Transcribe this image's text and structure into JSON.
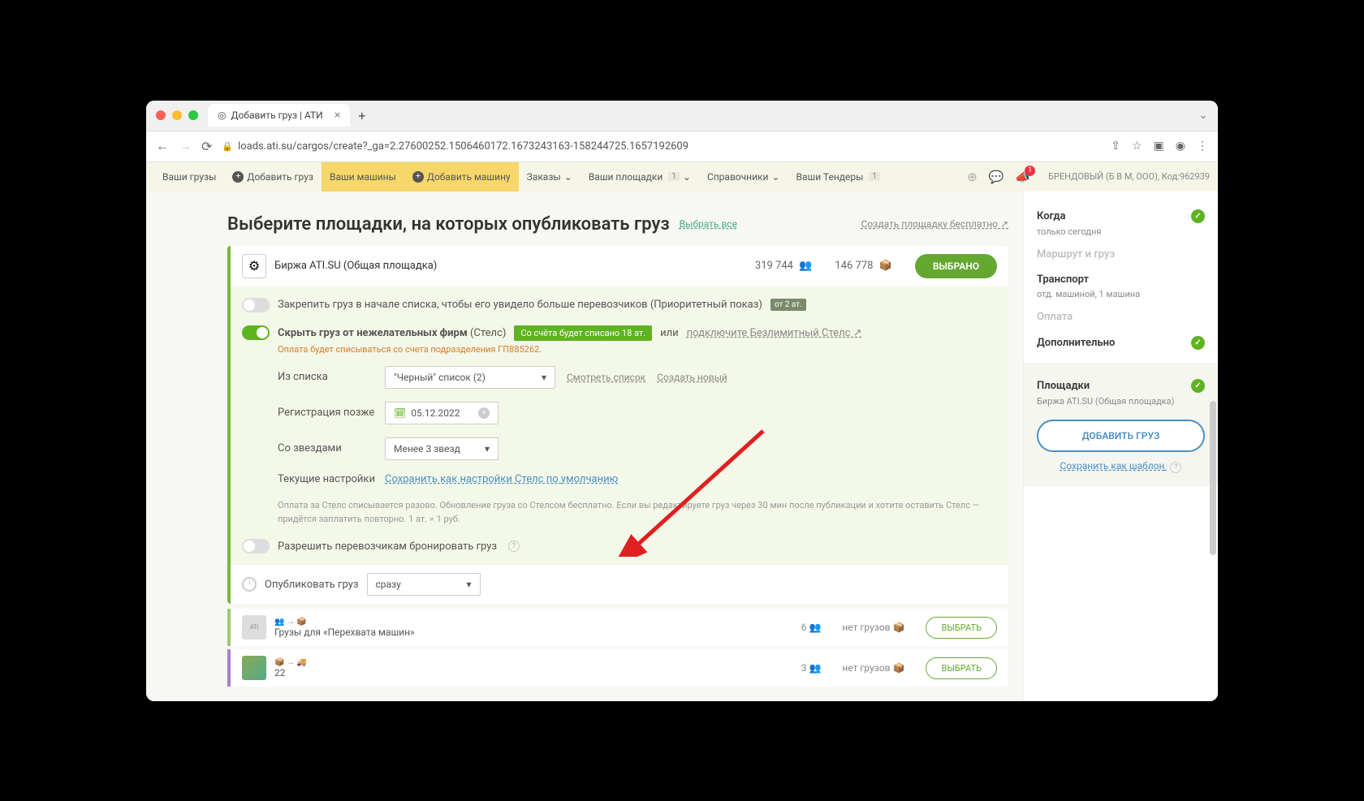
{
  "browser": {
    "tab_title": "Добавить груз | АТИ",
    "url": "loads.ati.su/cargos/create?_ga=2.27600252.1506460172.1673243163-158244725.1657192609"
  },
  "topnav": {
    "my_cargos": "Ваши грузы",
    "add_cargo": "Добавить груз",
    "my_vehicles": "Ваши машины",
    "add_vehicle": "Добавить машину",
    "orders": "Заказы",
    "my_platforms": "Ваши площадки",
    "platforms_badge": "1",
    "refs": "Справочники",
    "my_tenders": "Ваши Тендеры",
    "tenders_badge": "1",
    "noti_count": "1",
    "user": "БРЕНДОВЫЙ (Б В М, ООО),",
    "code": "Код:962939"
  },
  "head": {
    "title": "Выберите площадки, на которых опубликовать груз",
    "select_all": "Выбрать все",
    "create_platform": "Создать площадку бесплатно ↗"
  },
  "card": {
    "title": "Биржа ATI.SU (Общая площадка)",
    "stat1": "319 744",
    "stat2": "146 778",
    "selected_btn": "ВЫБРАНО"
  },
  "pin": {
    "text": "Закрепить груз в начале списка, чтобы его увидело больше перевозчиков (Приоритетный показ)",
    "badge": "от 2 ат."
  },
  "stealth": {
    "bold": "Скрыть груз от нежелательных фирм",
    "paren": "(Стелс)",
    "badge": "Со счёта будет списано 18 ат.",
    "or": "или",
    "link": "подключите Безлимитный Стелс ↗",
    "subtext": "Оплата будет списываться со счета подразделения ГП885262.",
    "from_list": "Из списка",
    "list_value": "\"Черный\" список (2)",
    "view_list": "Смотреть список",
    "create_new": "Создать новый",
    "reg_after": "Регистрация позже",
    "date": "05.12.2022",
    "stars": "Со звездами",
    "stars_value": "Менее 3 звезд",
    "current": "Текущие настройки",
    "save_default": "Сохранить как настройки Стелс по умолчанию",
    "help": "Оплата за Стелс списывается разово. Обновление груза со Стелсом бесплатно. Если вы редактируете груз через 30 мин после публикации и хотите оставить Стелс — придётся заплатить повторно. 1 ат. = 1 руб."
  },
  "booking": {
    "text": "Разрешить перевозчикам бронировать груз"
  },
  "publish": {
    "label": "Опубликовать груз",
    "value": "сразу"
  },
  "list": [
    {
      "title": "Грузы для «Перехвата машин»",
      "count": "6",
      "nocargo": "нет грузов",
      "btn": "ВЫБРАТЬ"
    },
    {
      "title": "22",
      "count": "3",
      "nocargo": "нет грузов",
      "btn": "ВЫБРАТЬ"
    }
  ],
  "side": {
    "when": "Когда",
    "when_sub": "только сегодня",
    "route": "Маршрут и груз",
    "transport": "Транспорт",
    "transport_sub": "отд. машиной, 1 машина",
    "payment": "Оплата",
    "extra": "Дополнительно",
    "platforms": "Площадки",
    "platforms_sub": "Биржа ATI.SU (Общая площадка)",
    "add_btn": "ДОБАВИТЬ ГРУЗ",
    "template": "Сохранить как шаблон"
  }
}
